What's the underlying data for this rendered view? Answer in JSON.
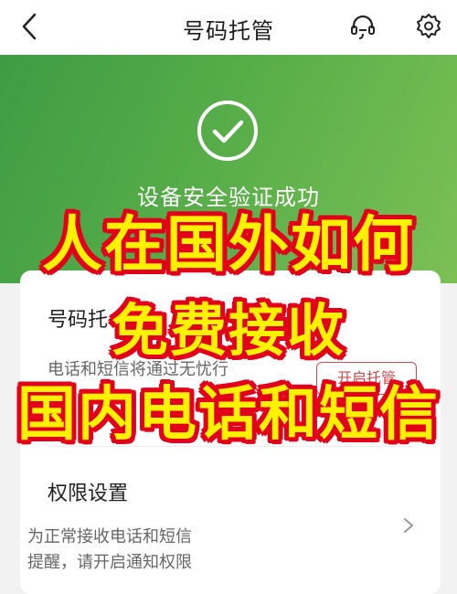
{
  "nav": {
    "title": "号码托管",
    "back_icon": "chevron-left-icon",
    "support_icon": "headset-icon",
    "settings_icon": "gear-icon"
  },
  "hero": {
    "status_icon": "check-circle-icon",
    "status_text": "设备安全验证成功",
    "gradient_colors": [
      "#3f9c44",
      "#7cc055"
    ]
  },
  "hosting_card": {
    "title": "号码托",
    "description": "电话和短信将通过无忧行",
    "button_label": "开启托管"
  },
  "permission": {
    "title": "权限设置",
    "description_lines": [
      "为正常接收电话和短信",
      "提醒，请开启通知权限"
    ]
  },
  "overlay_text": [
    "人在国外如何",
    "免费接收",
    "国内电话和短信"
  ],
  "colors": {
    "accent_green": "#56ad48",
    "overlay_fill": "#fff200",
    "overlay_stroke": "#e3001b"
  }
}
